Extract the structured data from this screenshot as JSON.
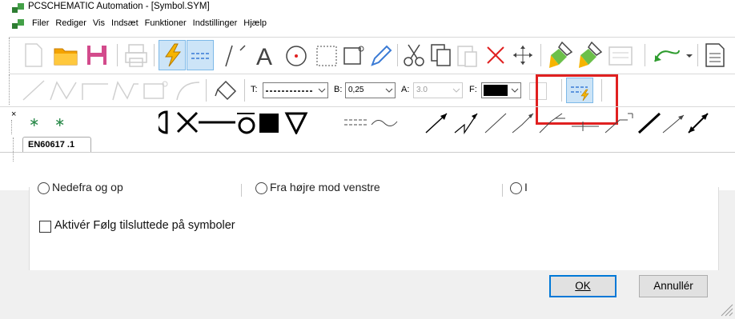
{
  "window": {
    "title": "PCSCHEMATIC Automation - [Symbol.SYM]"
  },
  "menu": [
    {
      "label": "Filer"
    },
    {
      "label": "Rediger"
    },
    {
      "label": "Vis"
    },
    {
      "label": "Indsæt"
    },
    {
      "label": "Funktioner"
    },
    {
      "label": "Indstillinger"
    },
    {
      "label": "Hjælp"
    }
  ],
  "toolbar2": {
    "t_label": "T:",
    "b_label": "B:",
    "b_value": "0,25",
    "a_label": "A:",
    "a_value": "3.0",
    "f_label": "F:",
    "fill_color": "#000000"
  },
  "symbol_tab": {
    "label": "EN60617 .1"
  },
  "dialog": {
    "radio1_label": "Nedefra og op",
    "radio2_label": "Fra højre mod venstre",
    "radio3_label": "I",
    "checkbox_label": "Aktivér Følg tilsluttede på symboler",
    "checkbox_checked": false,
    "ok_label": "OK",
    "cancel_label": "Annullér"
  },
  "highlight": {
    "color": "#e02020"
  }
}
